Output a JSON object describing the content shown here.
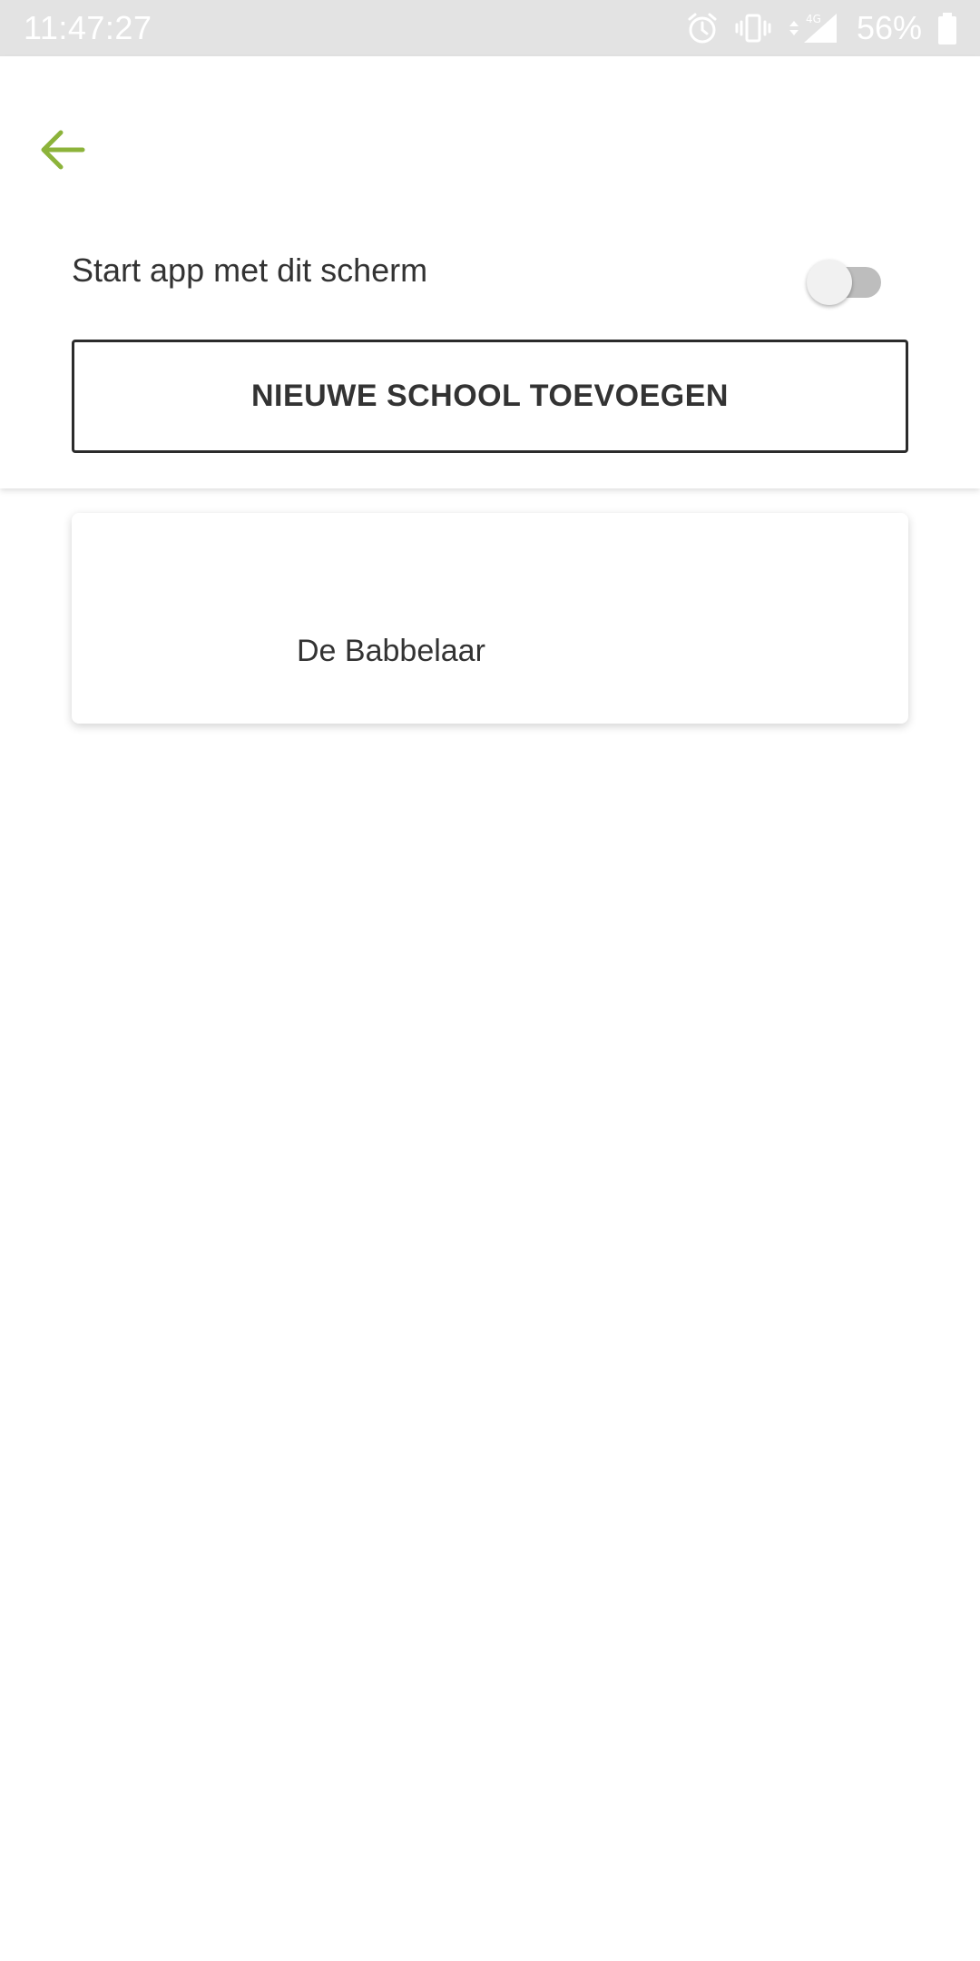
{
  "status_bar": {
    "time": "11:47:27",
    "battery_percent": "56%",
    "network_label": "4G",
    "icons": [
      "alarm-icon",
      "vibrate-icon",
      "data-arrows-icon",
      "signal-icon",
      "battery-icon"
    ]
  },
  "header": {
    "back_icon": "arrow-left-icon",
    "accent_color": "#8cb33a",
    "start_label": "Start app met dit scherm",
    "start_toggle_on": false,
    "add_school_label": "NIEUWE SCHOOL TOEVOEGEN"
  },
  "schools": [
    {
      "name": "De Babbelaar"
    }
  ]
}
